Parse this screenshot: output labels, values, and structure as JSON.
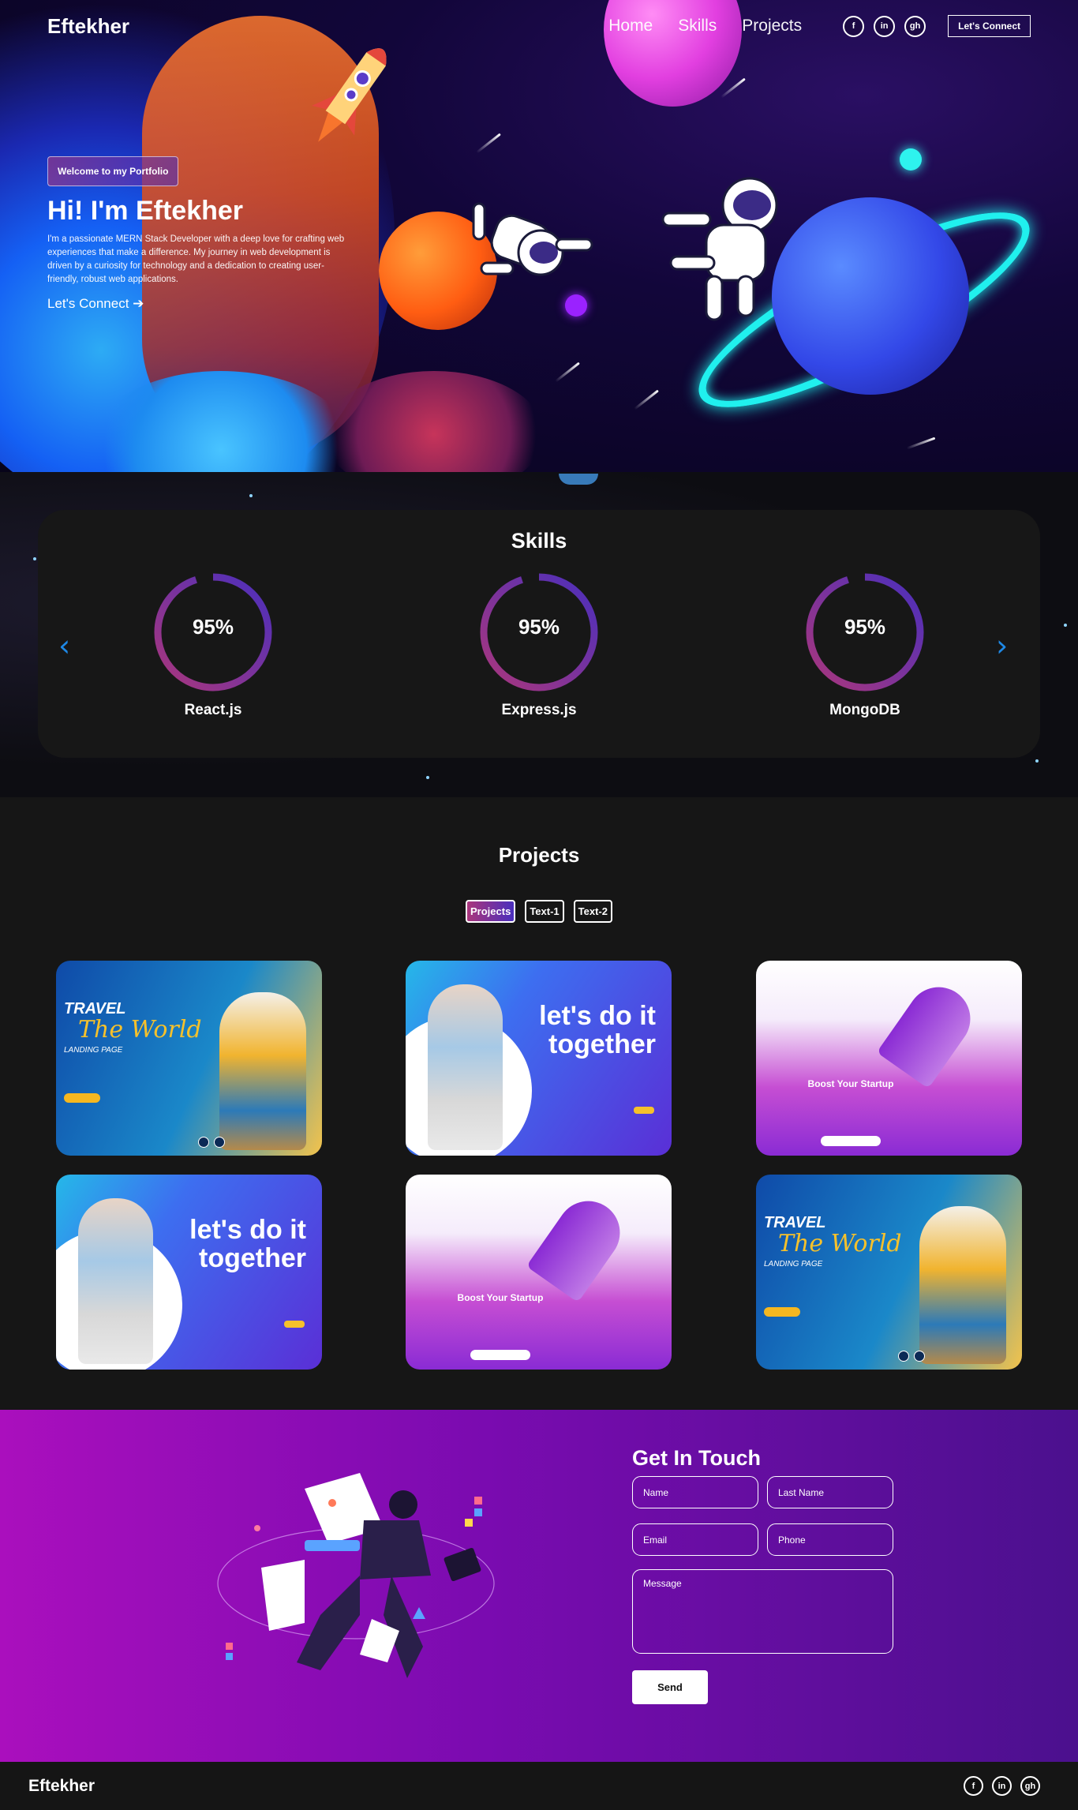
{
  "brand": "Eftekher",
  "nav": {
    "links": [
      "Home",
      "Skills",
      "Projects"
    ],
    "cta": "Let's Connect",
    "social": [
      {
        "icon": "facebook-icon",
        "glyph": "f"
      },
      {
        "icon": "linkedin-icon",
        "glyph": "in"
      },
      {
        "icon": "github-icon",
        "glyph": "gh"
      }
    ]
  },
  "hero": {
    "tagline": "Welcome to my Portfolio",
    "title": "Hi! I'm Eftekher",
    "description": "I'm a passionate MERN Stack Developer with a deep love for crafting web experiences that make a difference. My journey in web development is driven by a curiosity for technology and a dedication to creating user-friendly, robust web applications.",
    "connect": "Let's Connect ➔"
  },
  "skills": {
    "title": "Skills",
    "items": [
      {
        "name": "React.js",
        "percent": 95,
        "label": "95%"
      },
      {
        "name": "Express.js",
        "percent": 95,
        "label": "95%"
      },
      {
        "name": "MongoDB",
        "percent": 95,
        "label": "95%"
      }
    ],
    "prev": "‹",
    "next": "›"
  },
  "projects": {
    "title": "Projects",
    "tabs": [
      "Projects",
      "Text-1",
      "Text-2"
    ],
    "cards": {
      "travel": {
        "line1": "TRAVEL",
        "line2": "The World",
        "sub": "LANDING PAGE"
      },
      "together": {
        "text": "let's do it together"
      },
      "boost": {
        "text": "Boost Your Startup"
      }
    }
  },
  "contact": {
    "title": "Get In Touch",
    "placeholders": {
      "first_name": "Name",
      "last_name": "Last Name",
      "email": "Email",
      "phone": "Phone",
      "message": "Message"
    },
    "send": "Send"
  },
  "colors": {
    "accent_gradient_start": "#aa367c",
    "accent_gradient_end": "#4a2fbd",
    "contact_start": "#aa0fbd",
    "contact_end": "#4b108e"
  }
}
